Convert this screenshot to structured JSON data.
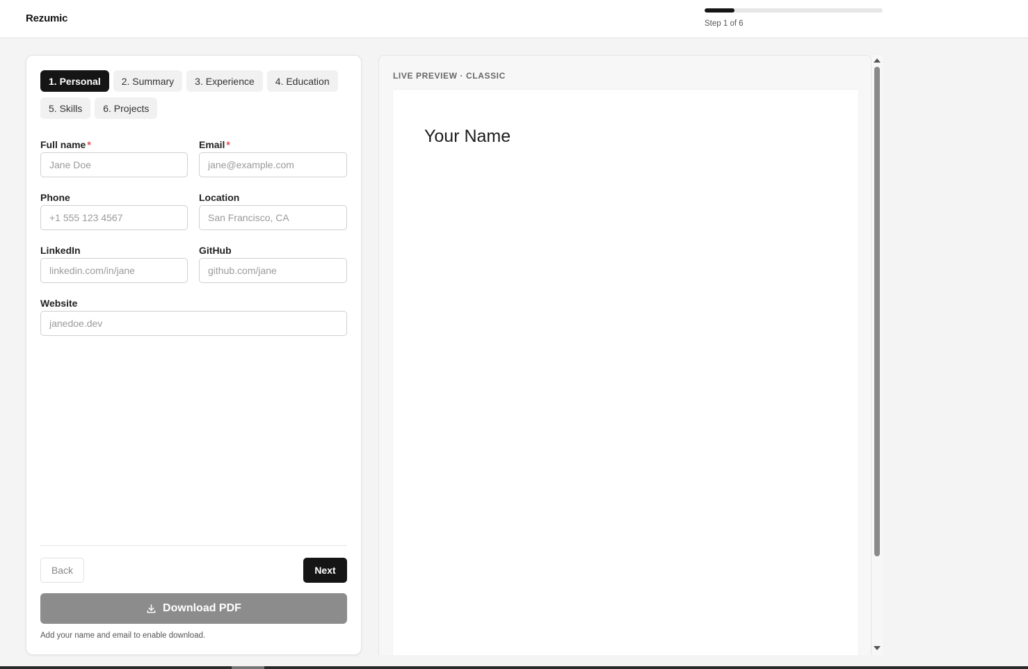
{
  "header": {
    "brand": "Rezumic",
    "step_text": "Step 1 of 6",
    "progress_fraction": 0.1667
  },
  "tabs": [
    {
      "label": "1. Personal",
      "active": true
    },
    {
      "label": "2. Summary",
      "active": false
    },
    {
      "label": "3. Experience",
      "active": false
    },
    {
      "label": "4. Education",
      "active": false
    },
    {
      "label": "5. Skills",
      "active": false
    },
    {
      "label": "6. Projects",
      "active": false
    }
  ],
  "form": {
    "full_name": {
      "label": "Full name",
      "required": "*",
      "placeholder": "Jane Doe",
      "value": ""
    },
    "email": {
      "label": "Email",
      "required": "*",
      "placeholder": "jane@example.com",
      "value": ""
    },
    "phone": {
      "label": "Phone",
      "placeholder": "+1 555 123 4567",
      "value": ""
    },
    "location": {
      "label": "Location",
      "placeholder": "San Francisco, CA",
      "value": ""
    },
    "linkedin": {
      "label": "LinkedIn",
      "placeholder": "linkedin.com/in/jane",
      "value": ""
    },
    "github": {
      "label": "GitHub",
      "placeholder": "github.com/jane",
      "value": ""
    },
    "website": {
      "label": "Website",
      "placeholder": "janedoe.dev",
      "value": ""
    }
  },
  "actions": {
    "back_label": "Back",
    "next_label": "Next",
    "download_label": "Download PDF",
    "download_icon": "download-icon",
    "hint": "Add your name and email to enable download."
  },
  "preview": {
    "label": "LIVE PREVIEW · CLASSIC",
    "name": "Your Name"
  },
  "colors": {
    "accent": "#151515",
    "required": "#e5484d",
    "disabled_button": "#8c8c8c"
  }
}
